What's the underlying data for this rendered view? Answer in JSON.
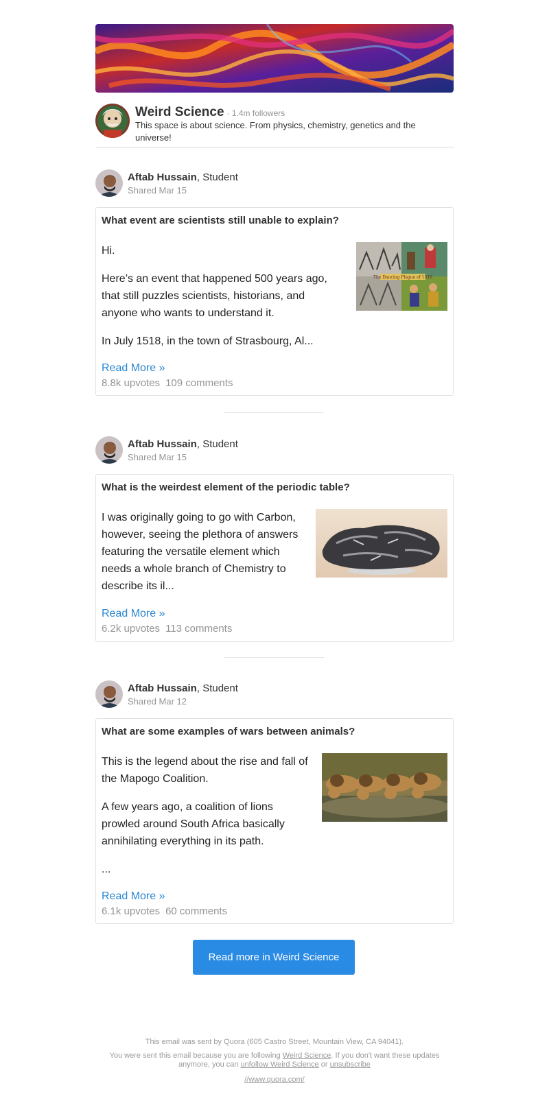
{
  "space": {
    "name": "Weird Science",
    "followers": "· 1.4m followers",
    "description": "This space is about science. From physics, chemistry, genetics and the universe!"
  },
  "posts": [
    {
      "author_name": "Aftab Hussain",
      "author_role": ", Student",
      "shared": "Shared Mar 15",
      "question": "What event are scientists still unable to explain?",
      "paragraphs": [
        "Hi.",
        "Here’s an event that happened 500 years ago, that still puzzles scientists, historians, and anyone who wants to understand it.",
        "In July 1518, in the town of Strasbourg, Al..."
      ],
      "image_caption": "The Dancing Plague of 1518",
      "read_more": "Read More »",
      "upvotes": "8.8k upvotes",
      "comments": "109 comments"
    },
    {
      "author_name": "Aftab Hussain",
      "author_role": ", Student",
      "shared": "Shared Mar 15",
      "question": "What is the weirdest element of the periodic table?",
      "paragraphs": [
        "I was originally going to go with Carbon, however, seeing the plethora of answers featuring the versatile element which needs a whole branch of Chemistry to describe its il..."
      ],
      "read_more": "Read More »",
      "upvotes": "6.2k upvotes",
      "comments": "113 comments"
    },
    {
      "author_name": "Aftab Hussain",
      "author_role": ", Student",
      "shared": "Shared Mar 12",
      "question": "What are some examples of wars between animals?",
      "paragraphs": [
        "This is the legend about the rise and fall of the Mapogo Coalition.",
        "A few years ago, a coalition of lions prowled around South Africa basically annihilating everything in its path.",
        "..."
      ],
      "read_more": "Read More »",
      "upvotes": "6.1k upvotes",
      "comments": "60 comments"
    }
  ],
  "cta": {
    "label": "Read more in Weird Science"
  },
  "footer": {
    "line1": "This email was sent by Quora (605 Castro Street, Mountain View, CA 94041).",
    "line2_a": "You were sent this email because you are following ",
    "line2_link": "Weird Science",
    "line2_b": ". If you don't want these updates anymore, you can ",
    "unfollow_link": "unfollow Weird Science",
    "or": " or ",
    "unsubscribe_link": "unsubscribe",
    "url": "//www.quora.com/"
  },
  "colors": {
    "link": "#2b87d1",
    "button": "#2a8be5",
    "muted": "#949494"
  }
}
